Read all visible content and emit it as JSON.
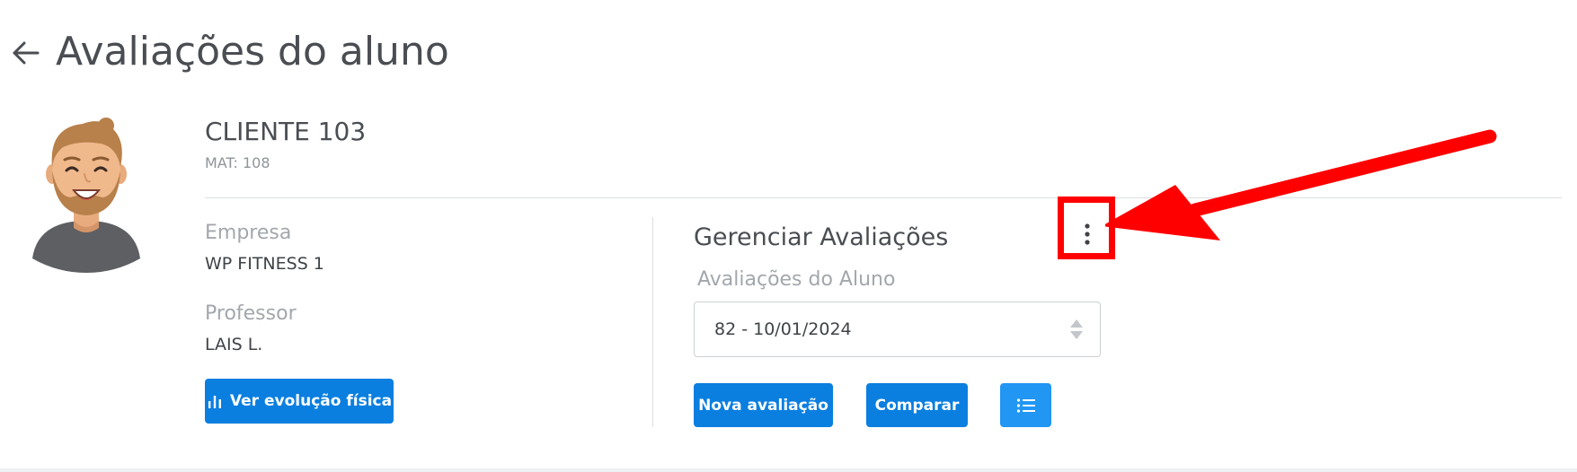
{
  "header": {
    "back_icon": "arrow-left-icon",
    "title": "Avaliações do aluno"
  },
  "client": {
    "avatar_icon": "bearded-man-avatar",
    "name": "CLIENTE 103",
    "mat": "MAT: 108"
  },
  "info": {
    "empresa_label": "Empresa",
    "empresa_value": "WP FITNESS 1",
    "professor_label": "Professor",
    "professor_value": "LAIS L."
  },
  "actions": {
    "evolucao_label": "Ver evolução física",
    "evolucao_icon": "bar-chart-icon"
  },
  "manage": {
    "title": "Gerenciar Avaliações",
    "menu_icon": "kebab-menu-icon",
    "select_label": "Avaliações do Aluno",
    "select_value": "82 - 10/01/2024",
    "nova_label": "Nova avaliação",
    "comparar_label": "Comparar",
    "list_icon": "list-icon"
  },
  "colors": {
    "primary": "#0a7fe0",
    "list_button": "#2196f3",
    "annotation": "#ff0000",
    "title_text": "#4a4d52",
    "muted_text": "#a3a7ac"
  }
}
